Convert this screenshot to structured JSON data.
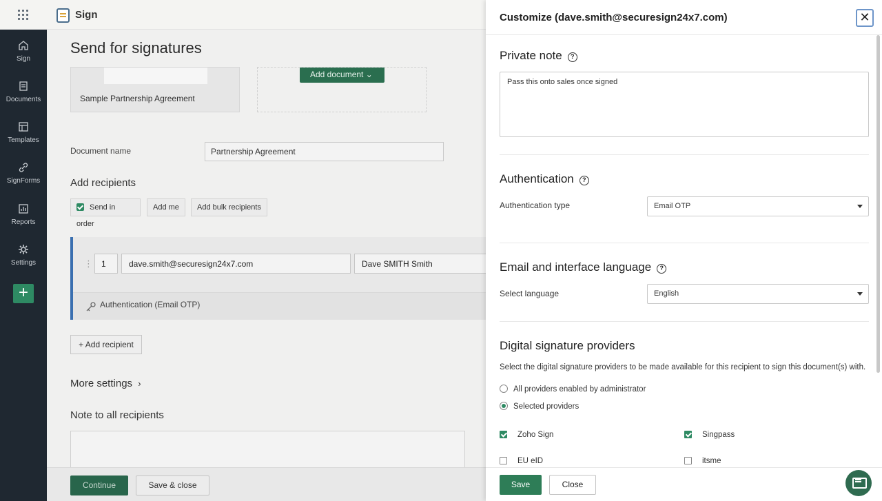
{
  "app": {
    "name": "Sign"
  },
  "sidebar": {
    "items": [
      {
        "label": "Sign",
        "icon": "home-icon"
      },
      {
        "label": "Documents",
        "icon": "documents-icon"
      },
      {
        "label": "Templates",
        "icon": "templates-icon"
      },
      {
        "label": "SignForms",
        "icon": "link-icon"
      },
      {
        "label": "Reports",
        "icon": "reports-icon"
      },
      {
        "label": "Settings",
        "icon": "gear-icon"
      }
    ],
    "add_label": "+"
  },
  "main": {
    "title": "Send for signatures",
    "document_card_name": "Sample Partnership Agreement",
    "add_document_label": "Add document",
    "document_name_label": "Document name",
    "document_name_value": "Partnership Agreement",
    "add_recipients_heading": "Add recipients",
    "send_in_order_label": "Send in order",
    "add_me_label": "Add me",
    "add_bulk_label": "Add bulk recipients",
    "recipient": {
      "order": "1",
      "email": "dave.smith@securesign24x7.com",
      "name": "Dave SMITH  Smith",
      "auth_text": "Authentication (Email OTP)"
    },
    "add_recipient_label": "+ Add recipient",
    "more_settings_label": "More settings",
    "note_heading": "Note to all recipients",
    "continue_label": "Continue",
    "save_close_label": "Save & close"
  },
  "panel": {
    "title": "Customize (dave.smith@securesign24x7.com)",
    "close_glyph": "✕",
    "private_note_heading": "Private note",
    "private_note_value": "Pass this onto sales once signed",
    "authentication_heading": "Authentication",
    "auth_type_label": "Authentication type",
    "auth_type_value": "Email OTP",
    "language_heading": "Email and interface language",
    "language_label": "Select language",
    "language_value": "English",
    "providers_heading": "Digital signature providers",
    "providers_desc": "Select the digital signature providers to be made available for this recipient to sign this document(s) with.",
    "radio_all": "All providers enabled by administrator",
    "radio_selected": "Selected providers",
    "providers": [
      {
        "label": "Zoho Sign",
        "checked": true
      },
      {
        "label": "Singpass",
        "checked": true
      },
      {
        "label": "EU eID",
        "checked": false
      },
      {
        "label": "itsme",
        "checked": false
      }
    ],
    "save_label": "Save",
    "close_label": "Close"
  },
  "colors": {
    "accent": "#2e8a63",
    "sidebar": "#1f2831",
    "recipient_bar": "#3a6fb0"
  }
}
